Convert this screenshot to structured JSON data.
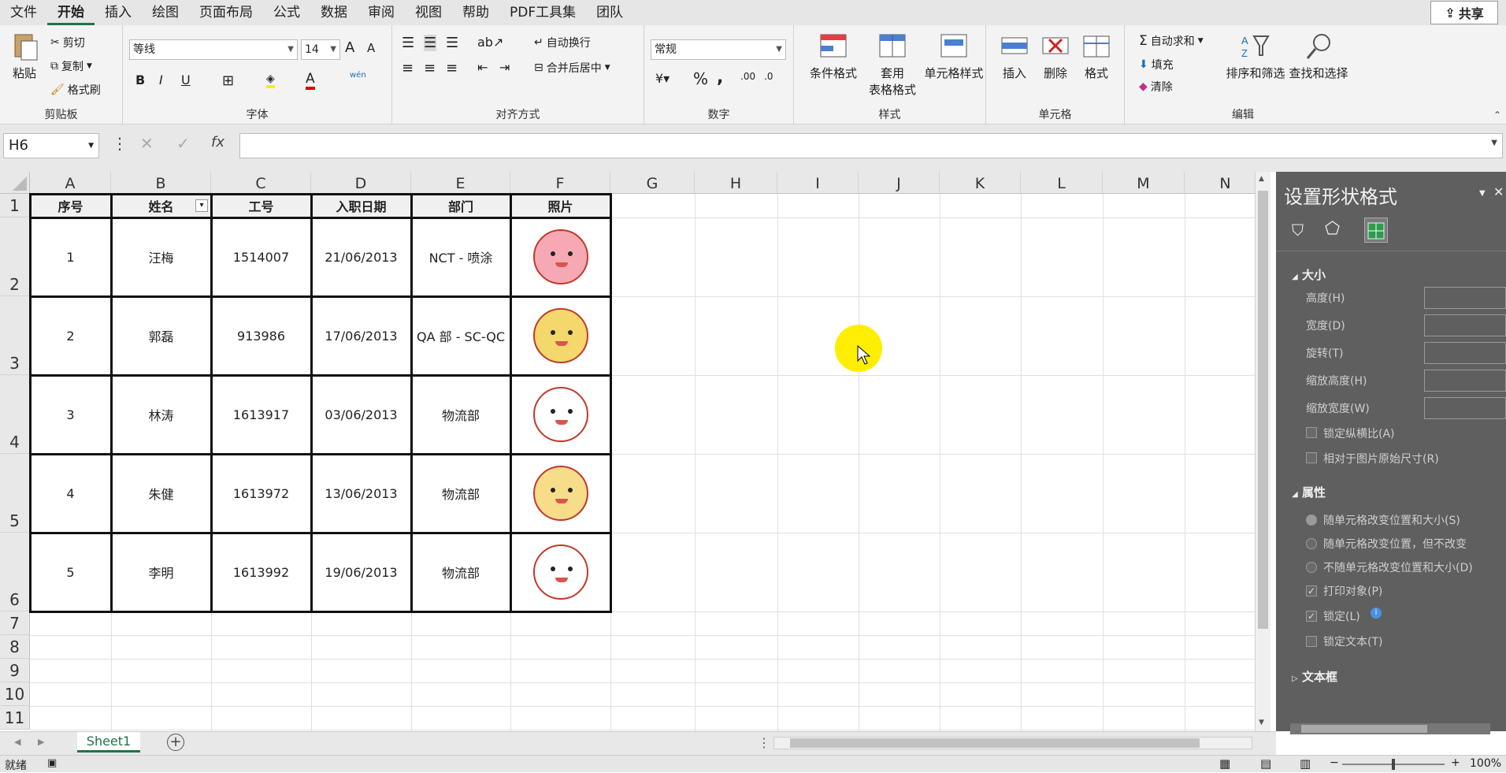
{
  "menu": {
    "tabs": [
      "文件",
      "开始",
      "插入",
      "绘图",
      "页面布局",
      "公式",
      "数据",
      "审阅",
      "视图",
      "帮助",
      "PDF工具集",
      "团队"
    ],
    "active_index": 1,
    "share_label": "共享"
  },
  "ribbon": {
    "clipboard": {
      "paste": "粘贴",
      "cut": "剪切",
      "copy": "复制",
      "format_painter": "格式刷",
      "label": "剪贴板"
    },
    "font": {
      "name": "等线",
      "size": "14",
      "label": "字体",
      "bold": "B",
      "italic": "I",
      "underline": "U",
      "grow": "A",
      "shrink": "A",
      "wen": "wén"
    },
    "alignment": {
      "wrap": "自动换行",
      "merge": "合并后居中",
      "label": "对齐方式"
    },
    "number": {
      "format": "常规",
      "percent": "%",
      "comma": ",",
      "label": "数字"
    },
    "styles": {
      "conditional": "条件格式",
      "table_line1": "套用",
      "table_line2": "表格格式",
      "cell_styles": "单元格样式",
      "label": "样式"
    },
    "cells": {
      "insert": "插入",
      "delete": "删除",
      "format": "格式",
      "label": "单元格"
    },
    "editing": {
      "autosum": "自动求和",
      "fill": "填充",
      "clear": "清除",
      "sort": "排序和筛选",
      "find": "查找和选择",
      "label": "编辑"
    }
  },
  "formula_bar": {
    "name_box": "H6",
    "fx": "fx",
    "value": ""
  },
  "sheet": {
    "columns": [
      "A",
      "B",
      "C",
      "D",
      "E",
      "F",
      "G",
      "H",
      "I",
      "J",
      "K",
      "L",
      "M",
      "N"
    ],
    "rows": [
      "1",
      "2",
      "3",
      "4",
      "5",
      "6",
      "7",
      "8",
      "9",
      "10",
      "11"
    ],
    "headers": [
      "序号",
      "姓名",
      "工号",
      "入职日期",
      "部门",
      "照片"
    ],
    "records": [
      [
        "1",
        "汪梅",
        "1514007",
        "21/06/2013",
        "NCT - 喷涂"
      ],
      [
        "2",
        "郭磊",
        "913986",
        "17/06/2013",
        "QA 部 - SC-QC"
      ],
      [
        "3",
        "林涛",
        "1613917",
        "03/06/2013",
        "物流部"
      ],
      [
        "4",
        "朱健",
        "1613972",
        "13/06/2013",
        "物流部"
      ],
      [
        "5",
        "李明",
        "1613992",
        "19/06/2013",
        "物流部"
      ]
    ],
    "photo_icons": [
      "pink-bear-icon",
      "yellow-duck-icon",
      "white-dog-icon",
      "pompompurin-icon",
      "hello-kitty-icon"
    ],
    "photo_colors": [
      "#f6a9b4",
      "#f5d86b",
      "#ffffff",
      "#f7dc8a",
      "#ffffff"
    ]
  },
  "sheet_tabs": {
    "active": "Sheet1",
    "add": "+"
  },
  "status": {
    "ready": "就绪",
    "zoom": "100%"
  },
  "pane": {
    "title": "设置形状格式",
    "size_section": "大小",
    "height": "高度(H)",
    "width": "宽度(D)",
    "rotation": "旋转(T)",
    "scale_h": "缩放高度(H)",
    "scale_w": "缩放宽度(W)",
    "lock_ratio": "锁定纵横比(A)",
    "relative_original": "相对于图片原始尺寸(R)",
    "props_section": "属性",
    "move_size": "随单元格改变位置和大小(S)",
    "move_only": "随单元格改变位置，但不改变",
    "no_move": "不随单元格改变位置和大小(D)",
    "print_obj": "打印对象(P)",
    "locked": "锁定(L)",
    "lock_text": "锁定文本(T)",
    "textbox_section": "文本框"
  },
  "colors": {
    "accent": "#217346",
    "pane_bg": "#5f5f5f",
    "cursor_highlight": "#ffee00"
  }
}
